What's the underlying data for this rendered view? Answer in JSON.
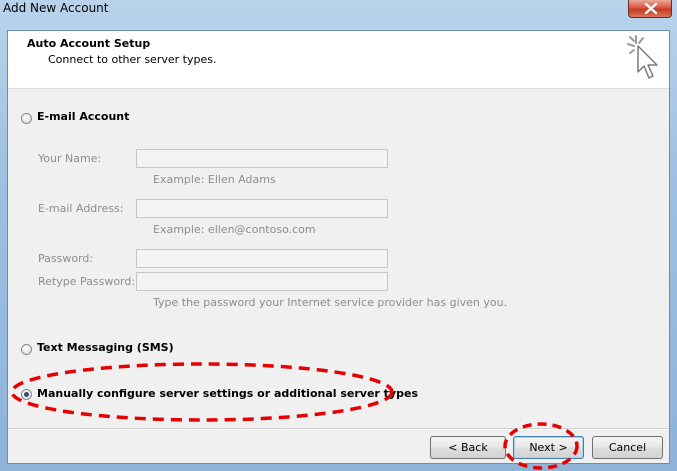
{
  "window": {
    "title": "Add New Account",
    "close_glyph": "×"
  },
  "header": {
    "title": "Auto Account Setup",
    "subtitle": "Connect to other server types."
  },
  "options": {
    "email_account": {
      "label": "E-mail Account",
      "selected": false,
      "fields": {
        "your_name": {
          "label": "Your Name:",
          "value": "",
          "example": "Example: Ellen Adams"
        },
        "email_address": {
          "label": "E-mail Address:",
          "value": "",
          "example": "Example: ellen@contoso.com"
        },
        "password": {
          "label": "Password:",
          "value": ""
        },
        "retype_password": {
          "label": "Retype Password:",
          "value": ""
        },
        "password_hint": "Type the password your Internet service provider has given you."
      }
    },
    "text_messaging": {
      "label": "Text Messaging (SMS)",
      "selected": false
    },
    "manual_config": {
      "label": "Manually configure server settings or additional server types",
      "selected": true
    }
  },
  "buttons": {
    "back": "< Back",
    "next": "Next >",
    "cancel": "Cancel"
  },
  "colors": {
    "annotation": "#e60000",
    "radio_selected": "#2b4f86"
  },
  "icons": {
    "wizard": "wizard-cursor-icon",
    "close": "close-icon"
  }
}
